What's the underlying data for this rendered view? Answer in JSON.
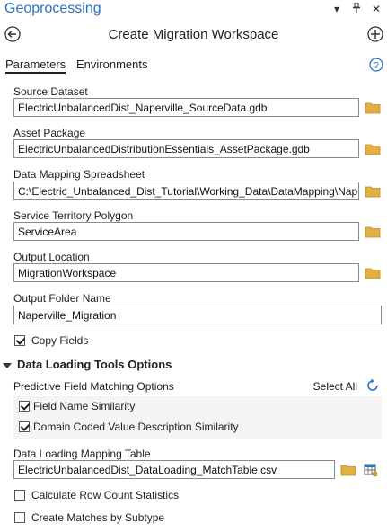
{
  "pane": {
    "title": "Geoprocessing",
    "icons": [
      "chevron-down-icon",
      "pin-icon",
      "close-icon"
    ]
  },
  "tool": {
    "title": "Create Migration Workspace"
  },
  "tabs": [
    {
      "label": "Parameters",
      "active": true
    },
    {
      "label": "Environments",
      "active": false
    }
  ],
  "params": {
    "source_dataset": {
      "label": "Source Dataset",
      "value": "ElectricUnbalancedDist_Naperville_SourceData.gdb"
    },
    "asset_package": {
      "label": "Asset Package",
      "value": "ElectricUnbalancedDistributionEssentials_AssetPackage.gdb"
    },
    "mapping_spreadsheet": {
      "label": "Data Mapping Spreadsheet",
      "value": "C:\\Electric_Unbalanced_Dist_Tutorial\\Working_Data\\DataMapping\\Nap"
    },
    "territory": {
      "label": "Service Territory Polygon",
      "value": "ServiceArea"
    },
    "output_location": {
      "label": "Output Location",
      "value": "MigrationWorkspace"
    },
    "output_folder": {
      "label": "Output Folder Name",
      "value": "Naperville_Migration"
    },
    "copy_fields": {
      "label": "Copy Fields",
      "checked": true
    }
  },
  "data_loading": {
    "section_label": "Data Loading Tools Options",
    "pfm_label": "Predictive Field Matching Options",
    "select_all": "Select All",
    "options": [
      {
        "label": "Field Name Similarity",
        "checked": true
      },
      {
        "label": "Domain Coded Value Description Similarity",
        "checked": true
      }
    ],
    "mapping_table": {
      "label": "Data Loading Mapping Table",
      "value": "ElectricUnbalancedDist_DataLoading_MatchTable.csv"
    },
    "row_count": {
      "label": "Calculate Row Count Statistics",
      "checked": false
    },
    "by_subtype": {
      "label": "Create Matches by Subtype",
      "checked": false
    }
  },
  "colors": {
    "accent": "#2a73c2",
    "folder": "#e3b043"
  }
}
